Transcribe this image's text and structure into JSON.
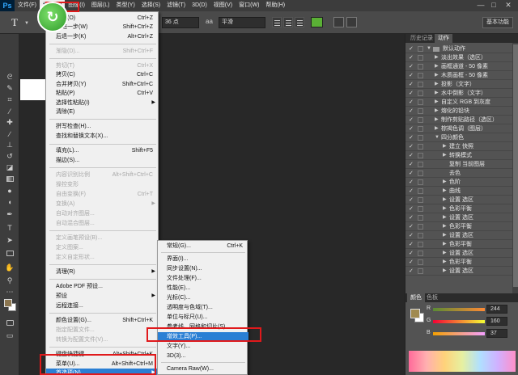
{
  "menubar": {
    "logo": "Ps",
    "items": [
      "文件(F)",
      "编辑(E)",
      "图像(I)",
      "图层(L)",
      "类型(Y)",
      "选择(S)",
      "滤镜(T)",
      "3D(D)",
      "视图(V)",
      "窗口(W)",
      "帮助(H)"
    ],
    "window_controls": [
      "—",
      "□",
      "✕"
    ]
  },
  "options_bar": {
    "tool_glyph": "T",
    "font_size": "36 点",
    "aa_icon": "aa",
    "aa_mode": "平滑",
    "workspace_button": "基本功能",
    "text_color": "#5ab035"
  },
  "edit_menu": {
    "items": [
      {
        "label": "还原(O)",
        "shortcut": "Ctrl+Z",
        "disabled": false
      },
      {
        "label": "前进一步(W)",
        "shortcut": "Shift+Ctrl+Z",
        "disabled": false
      },
      {
        "label": "后退一步(K)",
        "shortcut": "Alt+Ctrl+Z",
        "disabled": false
      },
      {
        "label": "渐隐(D)...",
        "shortcut": "Shift+Ctrl+F",
        "disabled": true
      },
      {
        "label": "剪切(T)",
        "shortcut": "Ctrl+X",
        "disabled": true
      },
      {
        "label": "拷贝(C)",
        "shortcut": "Ctrl+C",
        "disabled": false
      },
      {
        "label": "合并拷贝(Y)",
        "shortcut": "Shift+Ctrl+C",
        "disabled": false
      },
      {
        "label": "粘贴(P)",
        "shortcut": "Ctrl+V",
        "disabled": false
      },
      {
        "label": "选择性粘贴(I)",
        "shortcut": "",
        "disabled": false,
        "submenu": true
      },
      {
        "label": "清除(E)",
        "shortcut": "",
        "disabled": false
      },
      {
        "label": "拼写检查(H)...",
        "shortcut": "",
        "disabled": false
      },
      {
        "label": "查找和替换文本(X)...",
        "shortcut": "",
        "disabled": false
      },
      {
        "label": "填充(L)...",
        "shortcut": "Shift+F5",
        "disabled": false
      },
      {
        "label": "描边(S)...",
        "shortcut": "",
        "disabled": false
      },
      {
        "label": "内容识别比例",
        "shortcut": "Alt+Shift+Ctrl+C",
        "disabled": true
      },
      {
        "label": "操控变形",
        "shortcut": "",
        "disabled": true
      },
      {
        "label": "自由变换(F)",
        "shortcut": "Ctrl+T",
        "disabled": true
      },
      {
        "label": "变换(A)",
        "shortcut": "",
        "disabled": true,
        "submenu": true
      },
      {
        "label": "自动对齐图层...",
        "shortcut": "",
        "disabled": true
      },
      {
        "label": "自动混合图层...",
        "shortcut": "",
        "disabled": true
      },
      {
        "label": "定义画笔预设(B)...",
        "shortcut": "",
        "disabled": true
      },
      {
        "label": "定义图案...",
        "shortcut": "",
        "disabled": true
      },
      {
        "label": "定义自定形状...",
        "shortcut": "",
        "disabled": true
      },
      {
        "label": "清理(R)",
        "shortcut": "",
        "disabled": false,
        "submenu": true
      },
      {
        "label": "Adobe PDF 预设...",
        "shortcut": "",
        "disabled": false
      },
      {
        "label": "预设",
        "shortcut": "",
        "disabled": false,
        "submenu": true
      },
      {
        "label": "远程连接...",
        "shortcut": "",
        "disabled": false
      },
      {
        "label": "颜色设置(G)...",
        "shortcut": "Shift+Ctrl+K",
        "disabled": false
      },
      {
        "label": "指定配置文件...",
        "shortcut": "",
        "disabled": true
      },
      {
        "label": "转换为配置文件(V)...",
        "shortcut": "",
        "disabled": true
      },
      {
        "label": "键盘快捷键...",
        "shortcut": "Alt+Shift+Ctrl+K",
        "disabled": false
      },
      {
        "label": "菜单(U)...",
        "shortcut": "Alt+Shift+Ctrl+M",
        "disabled": false
      },
      {
        "label": "首选项(N)",
        "shortcut": "",
        "disabled": false,
        "submenu": true,
        "active": true
      }
    ]
  },
  "prefs_submenu": {
    "items": [
      {
        "label": "常规(G)...",
        "shortcut": "Ctrl+K"
      },
      {
        "label": "界面(I)...",
        "shortcut": ""
      },
      {
        "label": "同步设置(N)...",
        "shortcut": ""
      },
      {
        "label": "文件处理(F)...",
        "shortcut": ""
      },
      {
        "label": "性能(E)...",
        "shortcut": ""
      },
      {
        "label": "光标(C)...",
        "shortcut": ""
      },
      {
        "label": "透明度与色域(T)...",
        "shortcut": ""
      },
      {
        "label": "单位与标尺(U)...",
        "shortcut": ""
      },
      {
        "label": "参考线、网格和切片(S)...",
        "shortcut": ""
      },
      {
        "label": "增效工具(P)...",
        "shortcut": "",
        "active": true
      },
      {
        "label": "文字(Y)...",
        "shortcut": ""
      },
      {
        "label": "3D(3)...",
        "shortcut": ""
      },
      {
        "label": "Camera Raw(W)...",
        "shortcut": ""
      }
    ]
  },
  "actions_panel": {
    "tabs": [
      "历史记录",
      "动作"
    ],
    "rows": [
      {
        "name": "默认动作",
        "indent": 0,
        "folder": true,
        "expanded": true
      },
      {
        "name": "淡出效果（选区）",
        "indent": 1
      },
      {
        "name": "画框通道 - 50 像素",
        "indent": 1
      },
      {
        "name": "木质画框 - 50 像素",
        "indent": 1
      },
      {
        "name": "投影（文字）",
        "indent": 1
      },
      {
        "name": "水中倒影（文字）",
        "indent": 1
      },
      {
        "name": "自定义 RGB 到灰度",
        "indent": 1
      },
      {
        "name": "熔化的铅块",
        "indent": 1
      },
      {
        "name": "制作剪贴路径（选区）",
        "indent": 1
      },
      {
        "name": "棕褐色调（图层）",
        "indent": 1
      },
      {
        "name": "四分颜色",
        "indent": 1,
        "expanded": true
      },
      {
        "name": "建立 快照",
        "indent": 2
      },
      {
        "name": "转换模式",
        "indent": 2
      },
      {
        "name": "复制 当前图层",
        "indent": 2,
        "no_arrow": true
      },
      {
        "name": "去色",
        "indent": 2,
        "no_arrow": true
      },
      {
        "name": "色阶",
        "indent": 2
      },
      {
        "name": "曲线",
        "indent": 2
      },
      {
        "name": "设置 选区",
        "indent": 2
      },
      {
        "name": "色彩平衡",
        "indent": 2
      },
      {
        "name": "设置 选区",
        "indent": 2
      },
      {
        "name": "色彩平衡",
        "indent": 2
      },
      {
        "name": "设置 选区",
        "indent": 2
      },
      {
        "name": "色彩平衡",
        "indent": 2
      },
      {
        "name": "设置 选区",
        "indent": 2
      },
      {
        "name": "色彩平衡",
        "indent": 2
      },
      {
        "name": "设置 选区",
        "indent": 2
      }
    ]
  },
  "color_panel": {
    "tabs": [
      "颜色",
      "色板"
    ],
    "channels": [
      {
        "label": "R",
        "value": "244",
        "gradient": "linear-gradient(90deg, #5a8a34, #ff8a34)"
      },
      {
        "label": "G",
        "value": "160",
        "gradient": "linear-gradient(90deg, #f40034, #f4ff34)"
      },
      {
        "label": "B",
        "value": "37",
        "gradient": "linear-gradient(90deg, #f4a000, #f4a0ff)"
      }
    ],
    "fg_color": "#a08a50"
  }
}
